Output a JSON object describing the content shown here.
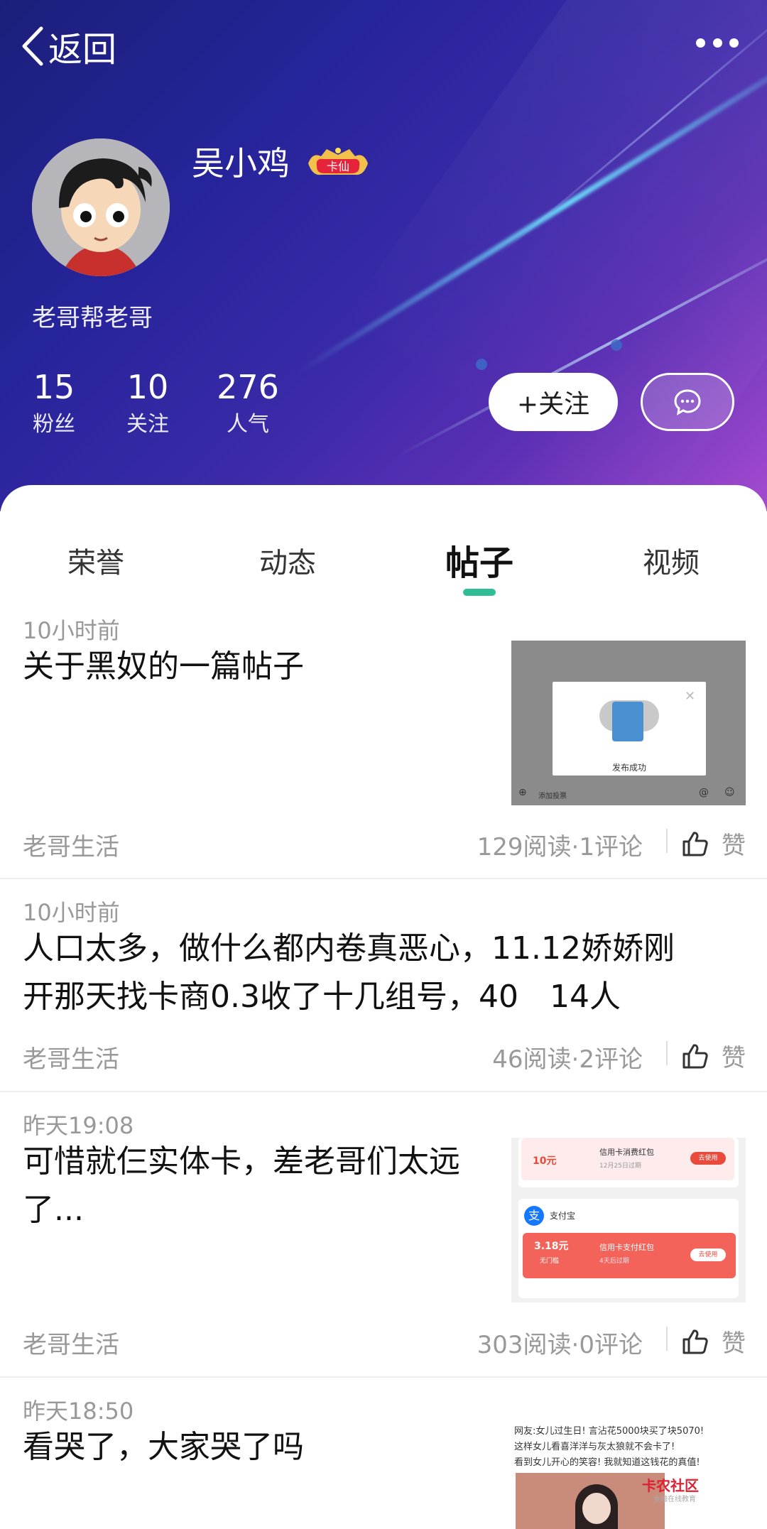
{
  "nav": {
    "back_label": "返回"
  },
  "profile": {
    "name": "吴小鸡",
    "badge_text": "卡仙",
    "signature": "老哥帮老哥",
    "stats": [
      {
        "value": "15",
        "label": "粉丝"
      },
      {
        "value": "10",
        "label": "关注"
      },
      {
        "value": "276",
        "label": "人气"
      }
    ],
    "follow_label": "+关注"
  },
  "tabs": [
    {
      "label": "荣誉",
      "active": false
    },
    {
      "label": "动态",
      "active": false
    },
    {
      "label": "帖子",
      "active": true
    },
    {
      "label": "视频",
      "active": false
    }
  ],
  "posts": [
    {
      "time": "10小时前",
      "title": "关于黑奴的一篇帖子",
      "category": "老哥生活",
      "meta": "129阅读·1评论",
      "like_label": "赞",
      "thumb": {
        "dialog_text": "发布成功",
        "toolbar_text": "添加投票"
      }
    },
    {
      "time": "10小时前",
      "title_line1": "人口太多，做什么都内卷真恶心，11.12娇娇刚",
      "title_line2": "开那天找卡商0.3收了十几组号，40　14人",
      "category": "老哥生活",
      "meta": "46阅读·2评论",
      "like_label": "赞"
    },
    {
      "time": "昨天19:08",
      "title_line1": "可惜就仨实体卡，差老哥们太远",
      "title_line2": "了...",
      "category": "老哥生活",
      "meta": "303阅读·0评论",
      "like_label": "赞",
      "thumb": {
        "card1_amount": "10元",
        "card1_title": "信用卡消费红包",
        "card1_sub": "12月25日过期",
        "card1_btn": "去使用",
        "app_name": "支付宝",
        "card2_amount": "3.18元",
        "card2_amount_sub": "无门槛",
        "card2_title": "信用卡支付红包",
        "card2_sub": "4天后过期",
        "card2_btn": "去使用"
      }
    },
    {
      "time": "昨天18:50",
      "title": "看哭了，大家哭了吗",
      "thumb": {
        "line1": "网友:女儿过生日! 言沾花5000块买了块5070!",
        "line2": "这样女儿看喜洋洋与灰太狼就不会卡了!",
        "line3": "看到女儿开心的笑容! 我就知道这钱花的真值!",
        "watermark": "卡农社区",
        "watermark_sub": "金融在线教育"
      }
    }
  ],
  "colors": {
    "accent": "#2ebd96",
    "header_start": "#1b1f7a",
    "header_end": "#a54bd0"
  }
}
